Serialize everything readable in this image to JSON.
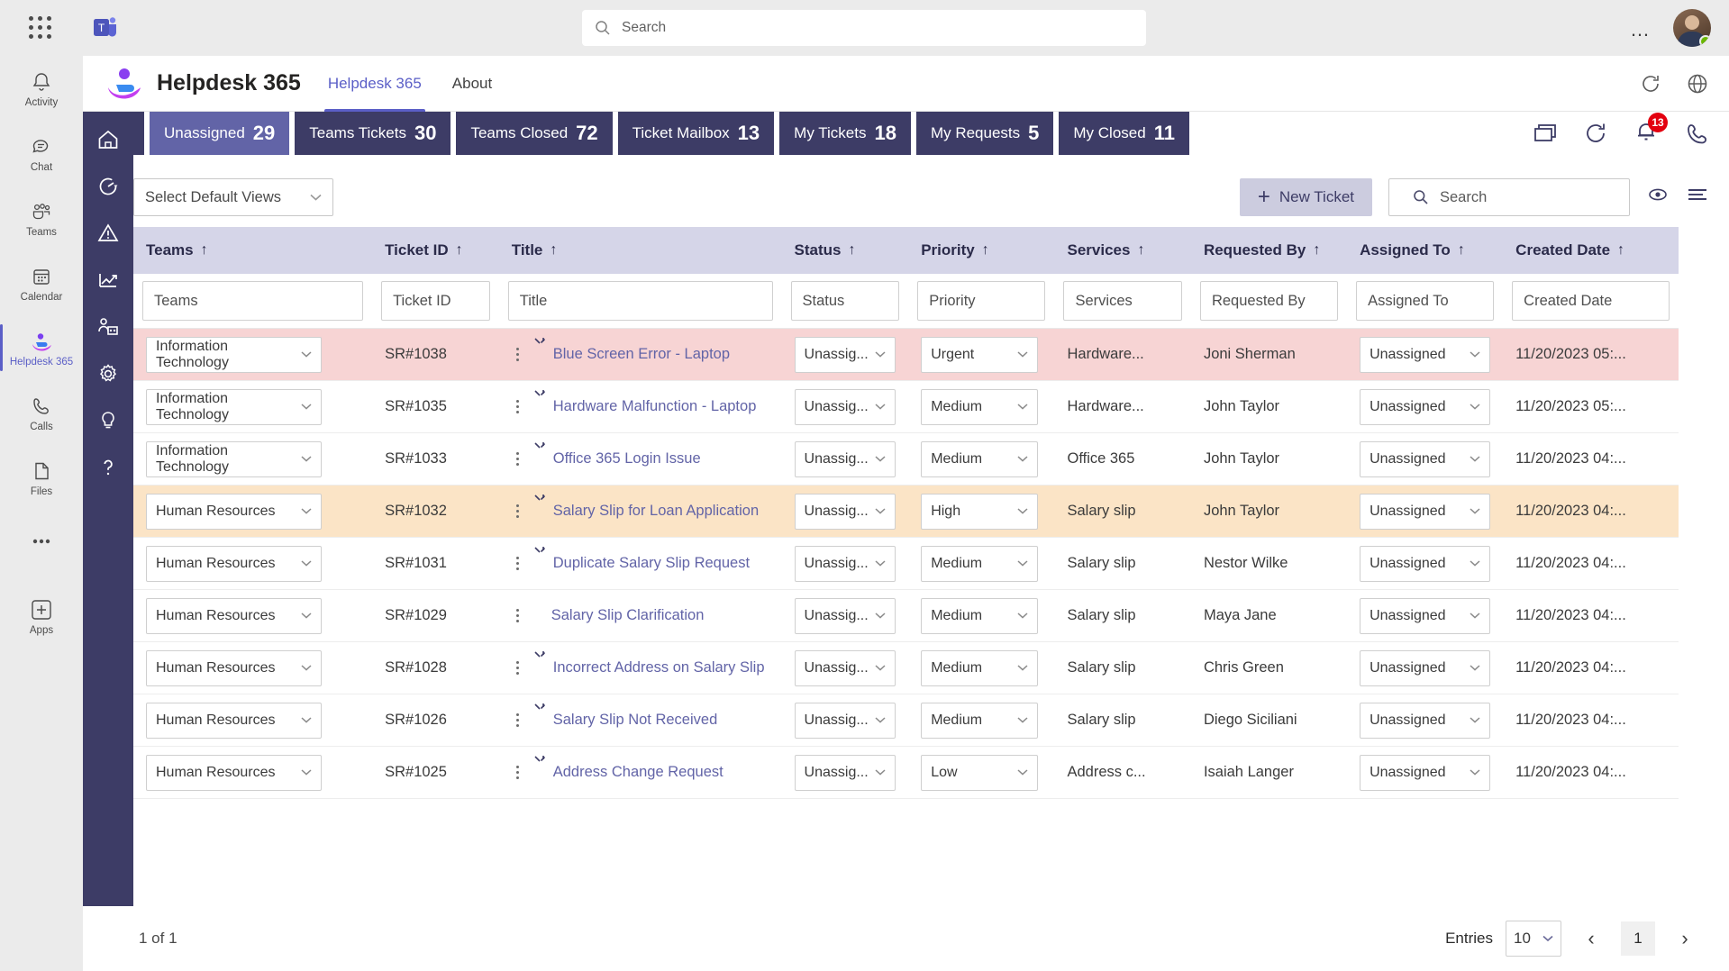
{
  "teams": {
    "search_placeholder": "Search",
    "waffle_icon": "app-launcher-icon",
    "logo_icon": "microsoft-teams-logo",
    "ellipsis_label": "…",
    "rail": [
      {
        "label": "Activity",
        "icon": "bell-icon",
        "active": false
      },
      {
        "label": "Chat",
        "icon": "chat-icon",
        "active": false
      },
      {
        "label": "Teams",
        "icon": "teams-icon",
        "active": false
      },
      {
        "label": "Calendar",
        "icon": "calendar-icon",
        "active": false
      },
      {
        "label": "Helpdesk 365",
        "icon": "helpdesk-icon",
        "active": true
      },
      {
        "label": "Calls",
        "icon": "phone-icon",
        "active": false
      },
      {
        "label": "Files",
        "icon": "file-icon",
        "active": false
      },
      {
        "label": "",
        "icon": "more-icon",
        "active": false
      },
      {
        "label": "Apps",
        "icon": "apps-icon",
        "active": false
      }
    ]
  },
  "app": {
    "title": "Helpdesk 365",
    "icon": "helpdesk-hand-icon",
    "tabs": [
      {
        "label": "Helpdesk 365",
        "active": true
      },
      {
        "label": "About",
        "active": false
      }
    ],
    "header_icons": [
      "refresh-icon",
      "globe-icon"
    ]
  },
  "viewtabs": {
    "menu_icon": "hamburger-icon",
    "items": [
      {
        "label": "Unassigned",
        "count": "29",
        "selected": true
      },
      {
        "label": "Teams Tickets",
        "count": "30",
        "selected": false
      },
      {
        "label": "Teams Closed",
        "count": "72",
        "selected": false
      },
      {
        "label": "Ticket Mailbox",
        "count": "13",
        "selected": false
      },
      {
        "label": "My Tickets",
        "count": "18",
        "selected": false
      },
      {
        "label": "My Requests",
        "count": "5",
        "selected": false
      },
      {
        "label": "My Closed",
        "count": "11",
        "selected": false
      }
    ],
    "right_icons": [
      {
        "name": "window-stack-icon"
      },
      {
        "name": "refresh-icon"
      },
      {
        "name": "notification-bell-icon",
        "badge": "13"
      },
      {
        "name": "phone-icon"
      }
    ]
  },
  "toolbar": {
    "default_views_label": "Select Default Views",
    "new_ticket_label": "New Ticket",
    "search_placeholder": "Search",
    "eye_icon": "eye-icon",
    "list-settings_icon": "list-settings-icon"
  },
  "grid": {
    "columns": [
      {
        "key": "teams",
        "label": "Teams",
        "sort": "↑"
      },
      {
        "key": "ticket_id",
        "label": "Ticket ID",
        "sort": "↑"
      },
      {
        "key": "title",
        "label": "Title",
        "sort": "↑"
      },
      {
        "key": "status",
        "label": "Status",
        "sort": "↑"
      },
      {
        "key": "priority",
        "label": "Priority",
        "sort": "↑"
      },
      {
        "key": "services",
        "label": "Services",
        "sort": "↑"
      },
      {
        "key": "requested_by",
        "label": "Requested By",
        "sort": "↑"
      },
      {
        "key": "assigned_to",
        "label": "Assigned To",
        "sort": "↑"
      },
      {
        "key": "created_date",
        "label": "Created Date",
        "sort": "↑"
      }
    ],
    "filters": [
      "Teams",
      "Ticket ID",
      "Title",
      "Status",
      "Priority",
      "Services",
      "Requested By",
      "Assigned To",
      "Created Date"
    ],
    "rows": [
      {
        "teams": "Information Technology",
        "ticket_id": "SR#1038",
        "title": "Blue Screen Error - Laptop",
        "status": "Unassig...",
        "priority": "Urgent",
        "services": "Hardware...",
        "requested_by": "Joni Sherman",
        "assigned_to": "Unassigned",
        "created_date": "11/20/2023 05:...",
        "highlight": "urgent",
        "new": true
      },
      {
        "teams": "Information Technology",
        "ticket_id": "SR#1035",
        "title": "Hardware Malfunction - Laptop",
        "status": "Unassig...",
        "priority": "Medium",
        "services": "Hardware...",
        "requested_by": "John Taylor",
        "assigned_to": "Unassigned",
        "created_date": "11/20/2023 05:...",
        "highlight": "",
        "new": true
      },
      {
        "teams": "Information Technology",
        "ticket_id": "SR#1033",
        "title": "Office 365 Login Issue",
        "status": "Unassig...",
        "priority": "Medium",
        "services": "Office 365",
        "requested_by": "John Taylor",
        "assigned_to": "Unassigned",
        "created_date": "11/20/2023 04:...",
        "highlight": "",
        "new": true
      },
      {
        "teams": "Human Resources",
        "ticket_id": "SR#1032",
        "title": "Salary Slip for Loan Application",
        "status": "Unassig...",
        "priority": "High",
        "services": "Salary slip",
        "requested_by": "John Taylor",
        "assigned_to": "Unassigned",
        "created_date": "11/20/2023 04:...",
        "highlight": "high",
        "new": true
      },
      {
        "teams": "Human Resources",
        "ticket_id": "SR#1031",
        "title": "Duplicate Salary Slip Request",
        "status": "Unassig...",
        "priority": "Medium",
        "services": "Salary slip",
        "requested_by": "Nestor Wilke",
        "assigned_to": "Unassigned",
        "created_date": "11/20/2023 04:...",
        "highlight": "",
        "new": true
      },
      {
        "teams": "Human Resources",
        "ticket_id": "SR#1029",
        "title": "Salary Slip Clarification",
        "status": "Unassig...",
        "priority": "Medium",
        "services": "Salary slip",
        "requested_by": "Maya Jane",
        "assigned_to": "Unassigned",
        "created_date": "11/20/2023 04:...",
        "highlight": "",
        "new": false
      },
      {
        "teams": "Human Resources",
        "ticket_id": "SR#1028",
        "title": "Incorrect Address on Salary Slip",
        "status": "Unassig...",
        "priority": "Medium",
        "services": "Salary slip",
        "requested_by": "Chris Green",
        "assigned_to": "Unassigned",
        "created_date": "11/20/2023 04:...",
        "highlight": "",
        "new": true
      },
      {
        "teams": "Human Resources",
        "ticket_id": "SR#1026",
        "title": "Salary Slip Not Received",
        "status": "Unassig...",
        "priority": "Medium",
        "services": "Salary slip",
        "requested_by": "Diego Siciliani",
        "assigned_to": "Unassigned",
        "created_date": "11/20/2023 04:...",
        "highlight": "",
        "new": true
      },
      {
        "teams": "Human Resources",
        "ticket_id": "SR#1025",
        "title": "Address Change Request",
        "status": "Unassig...",
        "priority": "Low",
        "services": "Address c...",
        "requested_by": "Isaiah Langer",
        "assigned_to": "Unassigned",
        "created_date": "11/20/2023 04:...",
        "highlight": "",
        "new": true
      }
    ]
  },
  "footer": {
    "page_info": "1 of 1",
    "entries_label": "Entries",
    "entries_value": "10",
    "prev_label": "‹",
    "page_number": "1",
    "next_label": "›"
  },
  "innerrail": [
    {
      "icon": "home-icon"
    },
    {
      "icon": "dashboard-icon"
    },
    {
      "icon": "alert-icon"
    },
    {
      "icon": "analytics-icon"
    },
    {
      "icon": "agents-icon"
    },
    {
      "icon": "settings-gear-icon"
    },
    {
      "icon": "lightbulb-icon"
    },
    {
      "icon": "help-icon"
    }
  ],
  "colors": {
    "accent": "#6264a7",
    "tab_dark": "#3d3c66",
    "header_bg": "#d5d5e8",
    "urgent_row": "#f7d4d4",
    "high_row": "#fbe4c6",
    "badge_red": "#e3000f"
  }
}
